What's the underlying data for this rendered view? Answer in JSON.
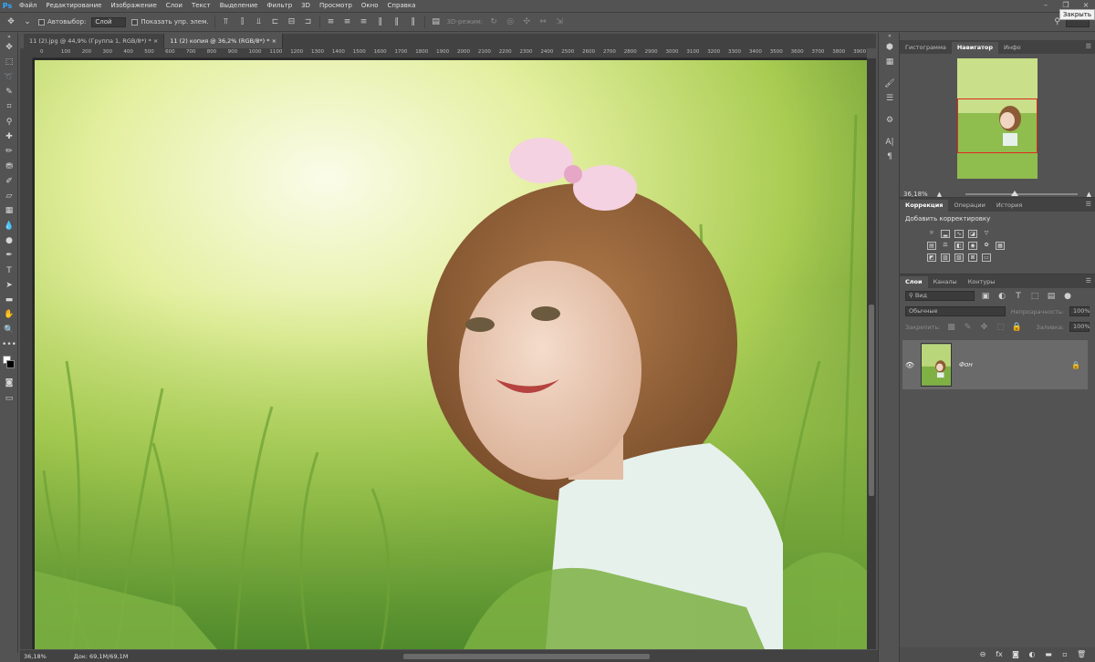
{
  "menubar": {
    "logo": "Ps",
    "items": [
      "Файл",
      "Редактирование",
      "Изображение",
      "Слои",
      "Текст",
      "Выделение",
      "Фильтр",
      "3D",
      "Просмотр",
      "Окно",
      "Справка"
    ],
    "tooltip": "Закрыть"
  },
  "options": {
    "autoselect_label": "Автовыбор:",
    "autoselect_value": "Слой",
    "show_controls_label": "Показать упр. элем.",
    "mode_3d_label": "3D-режим:"
  },
  "tabs": [
    {
      "label": "11 (2).jpg @ 44,9% (Группа 1, RGB/8*) *",
      "close": "×"
    },
    {
      "label": "11 (2) копия @ 36,2% (RGB/8*) *",
      "close": "×"
    }
  ],
  "ruler": {
    "ticks": [
      "0",
      "100",
      "200",
      "300",
      "400",
      "500",
      "600",
      "700",
      "800",
      "900",
      "1000",
      "1100",
      "1200",
      "1300",
      "1400",
      "1500",
      "1600",
      "1700",
      "1800",
      "1900",
      "2000",
      "2100",
      "2200",
      "2300",
      "2400",
      "2500",
      "2600",
      "2700",
      "2800",
      "2900",
      "3000",
      "3100",
      "3200",
      "3300",
      "3400",
      "3500",
      "3600",
      "3700",
      "3800",
      "3900"
    ]
  },
  "status": {
    "zoom": "36,18%",
    "doc": "Док: 69,1M/69,1M"
  },
  "navigator": {
    "tabs": [
      "Гистограмма",
      "Навигатор",
      "Инфо"
    ],
    "zoom": "36,18%"
  },
  "adjustments": {
    "tabs": [
      "Коррекция",
      "Операции",
      "История"
    ],
    "title": "Добавить корректировку"
  },
  "layers": {
    "tabs": [
      "Слои",
      "Каналы",
      "Контуры"
    ],
    "filter_placeholder": "Вид",
    "blend_mode": "Обычные",
    "opacity_label": "Непрозрачность:",
    "opacity_value": "100%",
    "lock_label": "Закрепить:",
    "fill_label": "Заливка:",
    "fill_value": "100%",
    "layer_name": "Фон"
  },
  "colors": {
    "accent": "#31a8ff",
    "nav_rect": "#e0281f"
  }
}
